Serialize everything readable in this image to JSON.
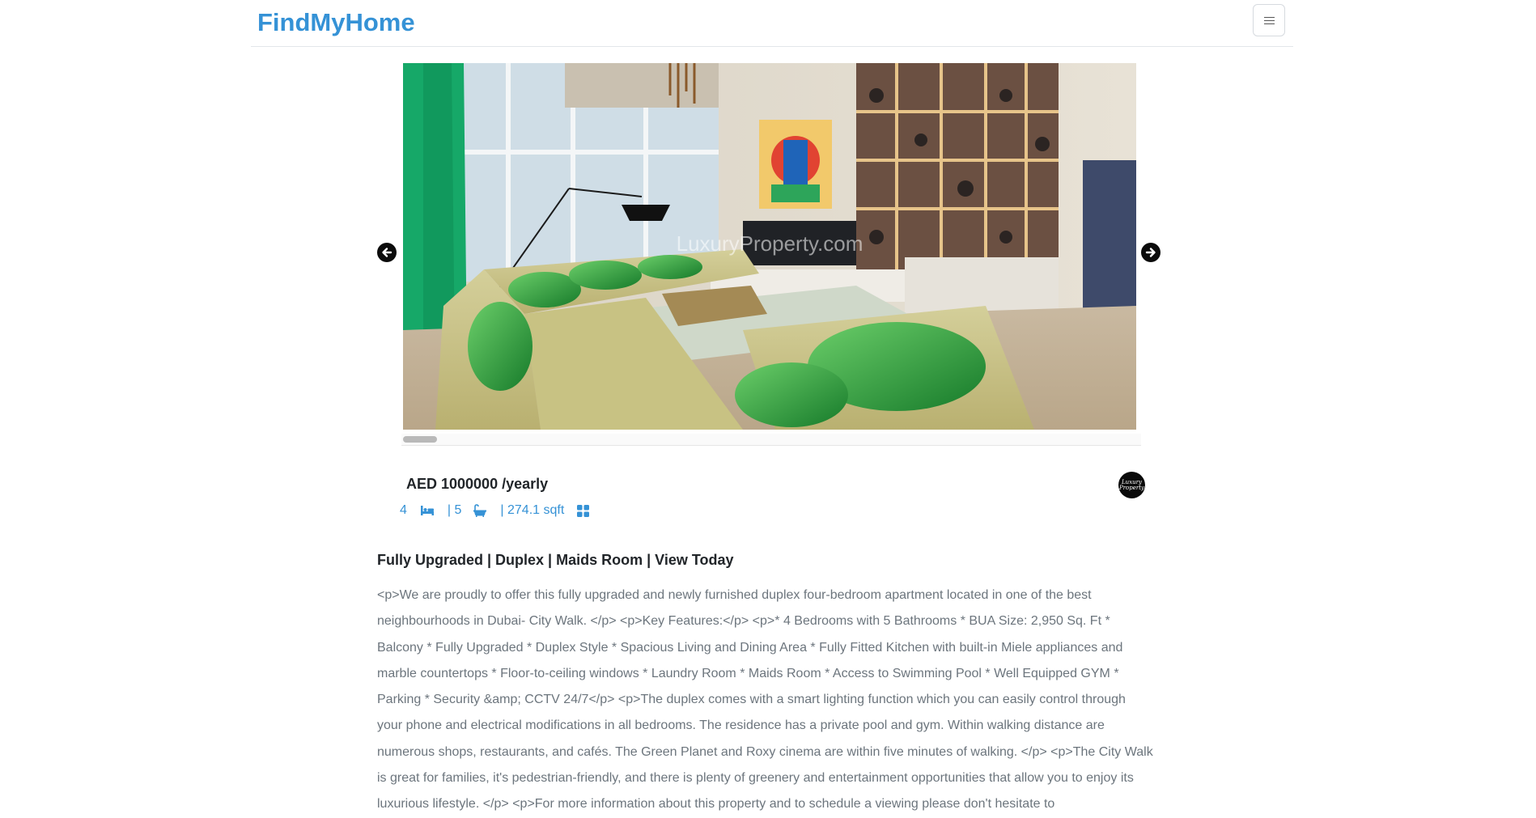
{
  "nav": {
    "brand": "FindMyHome",
    "menu_icon": "hamburger-icon"
  },
  "gallery": {
    "watermark": "LuxuryProperty.com",
    "prev_icon": "arrow-left-icon",
    "next_icon": "arrow-right-icon",
    "scroll_position": 0.0
  },
  "listing": {
    "price": "AED 1000000 /yearly",
    "bedrooms": "4",
    "bathrooms": "| 5",
    "area": "| 274.1 sqft",
    "agency_logo_text": "Luxury Property",
    "title": "Fully Upgraded | Duplex | Maids Room | View Today",
    "description": "<p>We are proudly to offer this fully upgraded and newly furnished duplex four-bedroom apartment located in one of the best neighbourhoods in Dubai- City Walk. </p> <p>Key Features:</p> <p>* 4 Bedrooms with 5 Bathrooms * BUA Size: 2,950 Sq. Ft * Balcony * Fully Upgraded * Duplex Style * Spacious Living and Dining Area * Fully Fitted Kitchen with built-in Miele appliances and marble countertops * Floor-to-ceiling windows * Laundry Room * Maids Room * Access to Swimming Pool * Well Equipped GYM * Parking * Security &amp; CCTV 24/7</p> <p>The duplex comes with a smart lighting function which you can easily control through your phone and electrical modifications in all bedrooms. The residence has a private pool and gym. Within walking distance are numerous shops, restaurants, and cafés. The Green Planet and Roxy cinema are within five minutes of walking. </p> <p>The City Walk is great for families, it's pedestrian-friendly, and there is plenty of greenery and entertainment opportunities that allow you to enjoy its luxurious lifestyle. </p> <p>For more information about this property and to schedule a viewing please don't hesitate to"
  },
  "colors": {
    "accent": "#3592d6",
    "text": "#212529",
    "muted": "#6c757d"
  }
}
